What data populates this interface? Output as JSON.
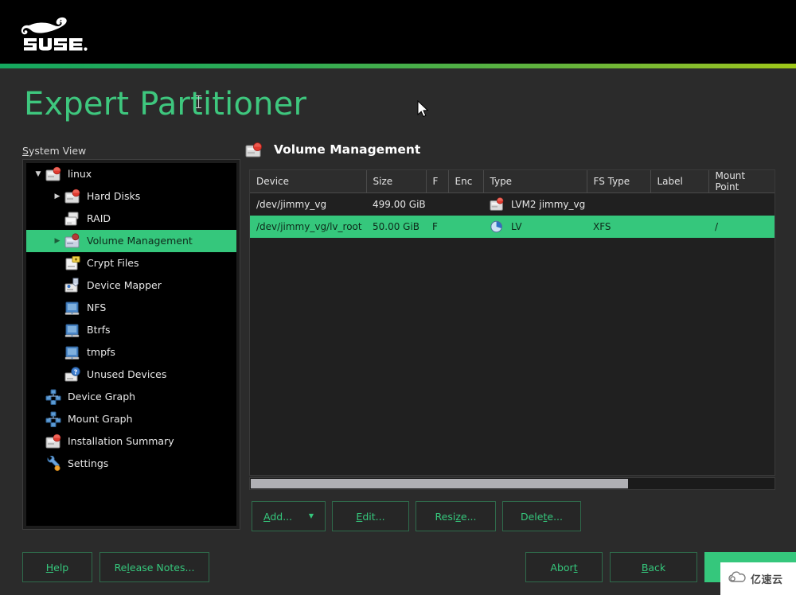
{
  "banner": {
    "logo_alt": "SUSE",
    "logo_text": "SUSE."
  },
  "page": {
    "title": "Expert Partitioner"
  },
  "sidebar": {
    "label_prefix": "S",
    "label_rest": "ystem View",
    "items": [
      {
        "label": "linux",
        "icon": "hard-disk-icon",
        "indent": 0,
        "twisty": "down",
        "selected": false
      },
      {
        "label": "Hard Disks",
        "icon": "hard-disk-icon",
        "indent": 1,
        "twisty": "right",
        "selected": false
      },
      {
        "label": "RAID",
        "icon": "raid-icon",
        "indent": 1,
        "twisty": "none",
        "selected": false
      },
      {
        "label": "Volume Management",
        "icon": "volume-management-icon",
        "indent": 1,
        "twisty": "right",
        "selected": true
      },
      {
        "label": "Crypt Files",
        "icon": "crypt-files-icon",
        "indent": 1,
        "twisty": "none",
        "selected": false
      },
      {
        "label": "Device Mapper",
        "icon": "device-mapper-icon",
        "indent": 1,
        "twisty": "none",
        "selected": false
      },
      {
        "label": "NFS",
        "icon": "folder-icon",
        "indent": 1,
        "twisty": "none",
        "selected": false
      },
      {
        "label": "Btrfs",
        "icon": "folder-icon",
        "indent": 1,
        "twisty": "none",
        "selected": false
      },
      {
        "label": "tmpfs",
        "icon": "folder-icon",
        "indent": 1,
        "twisty": "none",
        "selected": false
      },
      {
        "label": "Unused Devices",
        "icon": "unused-devices-icon",
        "indent": 1,
        "twisty": "none",
        "selected": false
      },
      {
        "label": "Device Graph",
        "icon": "graph-icon",
        "indent": 0,
        "twisty": "none",
        "selected": false
      },
      {
        "label": "Mount Graph",
        "icon": "graph-icon",
        "indent": 0,
        "twisty": "none",
        "selected": false
      },
      {
        "label": "Installation Summary",
        "icon": "hard-disk-icon",
        "indent": 0,
        "twisty": "none",
        "selected": false
      },
      {
        "label": "Settings",
        "icon": "wrench-icon",
        "indent": 0,
        "twisty": "none",
        "selected": false
      }
    ]
  },
  "content": {
    "heading": "Volume Management",
    "heading_icon": "volume-management-icon",
    "table": {
      "columns": [
        "Device",
        "Size",
        "F",
        "Enc",
        "Type",
        "FS Type",
        "Label",
        "Mount Point"
      ],
      "rows": [
        {
          "selected": false,
          "icon": "lvm-vg-icon",
          "cells": {
            "device": "/dev/jimmy_vg",
            "size": "499.00 GiB",
            "f": "",
            "enc": "",
            "type": "LVM2 jimmy_vg",
            "fs_type": "",
            "label": "",
            "mount_point": ""
          }
        },
        {
          "selected": true,
          "icon": "lv-icon",
          "cells": {
            "device": "/dev/jimmy_vg/lv_root",
            "size": "50.00 GiB",
            "f": "F",
            "enc": "",
            "type": "LV",
            "fs_type": "XFS",
            "label": "",
            "mount_point": "/"
          }
        }
      ]
    },
    "scrollbar": {
      "orientation": "horizontal",
      "thumb_percent": 72
    }
  },
  "actions": {
    "add": {
      "acc": "A",
      "rest": "dd...",
      "has_dropdown": true,
      "caret": "▼"
    },
    "edit": {
      "pre": "",
      "acc": "E",
      "rest": "dit..."
    },
    "resize": {
      "pre": "Resi",
      "acc": "z",
      "rest": "e..."
    },
    "delete": {
      "pre": "Dele",
      "acc": "t",
      "rest": "e..."
    }
  },
  "footer": {
    "help": {
      "acc": "H",
      "rest": "elp"
    },
    "release_notes": {
      "pre": "Re",
      "acc": "l",
      "rest": "ease Notes..."
    },
    "abort": {
      "pre": "Abor",
      "acc": "t",
      "rest": ""
    },
    "back": {
      "acc": "B",
      "rest": "ack"
    },
    "next": {
      "label": ""
    }
  },
  "watermark": {
    "text": "亿速云"
  },
  "colors": {
    "accent_green": "#35c77c",
    "title_green": "#3ec77e",
    "banner_black": "#000000",
    "page_bg": "#2b2b2b",
    "panel_bg": "#202020",
    "header_bg": "#2d2d2d",
    "scrollbar_thumb": "#b0b0b4"
  }
}
